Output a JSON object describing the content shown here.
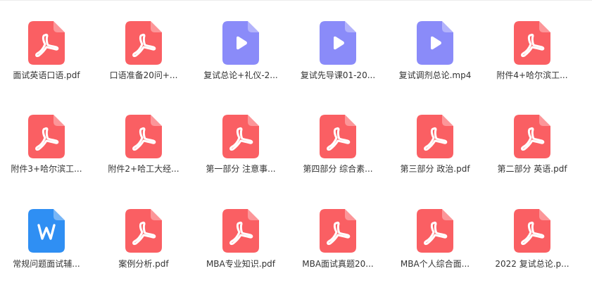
{
  "colors": {
    "pdf": "#fa5f63",
    "video": "#8a8bf9",
    "word": "#2f8ff3",
    "icon_glyph": "#ffffff",
    "text": "#333333",
    "background": "#ffffff"
  },
  "files": [
    {
      "name": "面试英语口语.pdf",
      "type": "pdf",
      "icon": "pdf-icon"
    },
    {
      "name": "口语准备20问+...",
      "type": "pdf",
      "icon": "pdf-icon"
    },
    {
      "name": "复试总论+礼仪-2...",
      "type": "video",
      "icon": "play-icon"
    },
    {
      "name": "复试先导课01-20...",
      "type": "video",
      "icon": "play-icon"
    },
    {
      "name": "复试调剂总论.mp4",
      "type": "video",
      "icon": "play-icon"
    },
    {
      "name": "附件4+哈尔滨工...",
      "type": "pdf",
      "icon": "pdf-icon"
    },
    {
      "name": "附件3+哈尔滨工...",
      "type": "pdf",
      "icon": "pdf-icon"
    },
    {
      "name": "附件2+哈工大经...",
      "type": "pdf",
      "icon": "pdf-icon"
    },
    {
      "name": "第一部分 注意事...",
      "type": "pdf",
      "icon": "pdf-icon"
    },
    {
      "name": "第四部分 综合素...",
      "type": "pdf",
      "icon": "pdf-icon"
    },
    {
      "name": "第三部分 政治.pdf",
      "type": "pdf",
      "icon": "pdf-icon"
    },
    {
      "name": "第二部分 英语.pdf",
      "type": "pdf",
      "icon": "pdf-icon"
    },
    {
      "name": "常规问题面试辅...",
      "type": "word",
      "icon": "word-icon"
    },
    {
      "name": "案例分析.pdf",
      "type": "pdf",
      "icon": "pdf-icon"
    },
    {
      "name": "MBA专业知识.pdf",
      "type": "pdf",
      "icon": "pdf-icon"
    },
    {
      "name": "MBA面试真题20...",
      "type": "pdf",
      "icon": "pdf-icon"
    },
    {
      "name": "MBA个人综合面...",
      "type": "pdf",
      "icon": "pdf-icon"
    },
    {
      "name": "2022 复试总论.p...",
      "type": "pdf",
      "icon": "pdf-icon"
    }
  ]
}
